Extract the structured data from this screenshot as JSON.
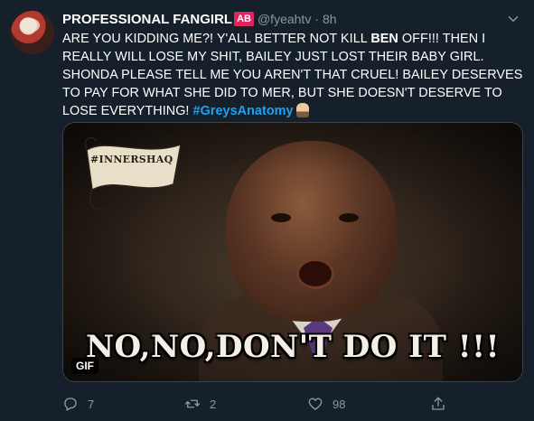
{
  "tweet": {
    "display_name": "PROFESSIONAL FANGIRL",
    "name_badge": "AB",
    "handle": "@fyeahtv",
    "separator": "·",
    "time": "8h",
    "text_part1": "ARE YOU KIDDING ME?! Y'ALL BETTER NOT KILL ",
    "text_bold": "BEN",
    "text_part2": " OFF!!! THEN I REALLY WILL LOSE MY SHIT, BAILEY JUST LOST THEIR BABY GIRL. SHONDA PLEASE TELL ME YOU AREN'T THAT CRUEL! BAILEY DESERVES TO PAY FOR WHAT SHE DID TO MER, BUT SHE DOESN'T DESERVE TO LOSE EVERYTHING! ",
    "hashtag": "#GreysAnatomy",
    "emoji": "person-emoji"
  },
  "media": {
    "type": "gif",
    "badge": "GIF",
    "banner_text": "#INNERSHAQ",
    "caption": "NO,NO,DON'T DO IT !!!"
  },
  "actions": {
    "reply_count": "7",
    "retweet_count": "2",
    "like_count": "98"
  },
  "icons": {
    "reply": "reply-icon",
    "retweet": "retweet-icon",
    "like": "heart-icon",
    "share": "share-icon",
    "caret": "chevron-down-icon"
  },
  "colors": {
    "background": "#15202b",
    "accent": "#1da1f2",
    "secondary_text": "#8899a6",
    "badge": "#e0245e"
  }
}
